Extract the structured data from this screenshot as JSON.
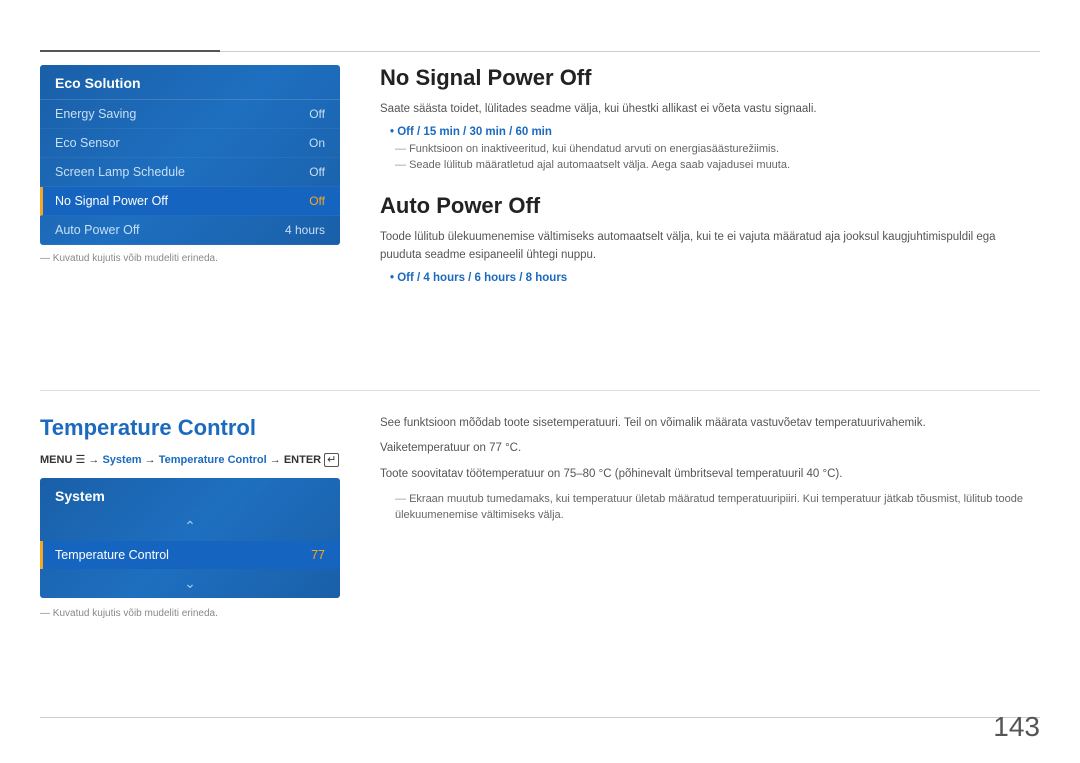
{
  "topSection": {
    "ecoMenu": {
      "title": "Eco Solution",
      "items": [
        {
          "label": "Energy Saving",
          "value": "Off",
          "active": false
        },
        {
          "label": "Eco Sensor",
          "value": "On",
          "active": false
        },
        {
          "label": "Screen Lamp Schedule",
          "value": "Off",
          "active": false
        },
        {
          "label": "No Signal Power Off",
          "value": "Off",
          "active": true
        },
        {
          "label": "Auto Power Off",
          "value": "4 hours",
          "active": false
        }
      ]
    },
    "footnote": "Kuvatud kujutis võib mudeliti erineda."
  },
  "noSignalSection": {
    "title": "No Signal Power Off",
    "desc": "Saate säästa toidet, lülitades seadme välja, kui ühestki allikast ei võeta vastu signaali.",
    "highlight": "Off / 15 min / 30 min / 60 min",
    "notes": [
      "Funktsioon on inaktiveeritud, kui ühendatud arvuti on energiasäästurežiimis.",
      "Seade lülitub määratletud ajal automaatselt välja. Aega saab vajadusei muuta."
    ]
  },
  "autoPowerSection": {
    "title": "Auto Power Off",
    "desc": "Toode lülitub ülekuumenemise vältimiseks automaatselt välja, kui te ei vajuta määratud aja jooksul kaugjuhtimispuldil ega puuduta seadme esipaneelil ühtegi nuppu.",
    "highlight": "Off / 4 hours / 6 hours / 8 hours"
  },
  "temperatureSection": {
    "heading": "Temperature Control",
    "menuPath": {
      "prefix": "MENU",
      "icon": "☰",
      "arrow1": "→",
      "system": "System",
      "arrow2": "→",
      "control": "Temperature Control",
      "arrow3": "→",
      "enter": "ENTER",
      "enterIcon": "↵"
    },
    "systemMenu": {
      "title": "System",
      "item": "Temperature Control",
      "value": "77"
    },
    "footnote": "Kuvatud kujutis võib mudeliti erineda.",
    "desc1": "See funktsioon mõõdab toote sisetemperatuuri. Teil on võimalik määrata vastuvõetav temperatuurivahemik.",
    "desc2": "Vaiketemperatuur on 77 °C.",
    "desc3": "Toote soovitatav töötemperatuur on 75–80 °C (põhinevalt ümbritseval temperatuuril 40 °C).",
    "note": "Ekraan muutub tumedamaks, kui temperatuur ületab määratud temperatuuripiiri. Kui temperatuur jätkab tõusmist, lülitub toode ülekuumenemise vältimiseks välja."
  },
  "pageNumber": "143"
}
